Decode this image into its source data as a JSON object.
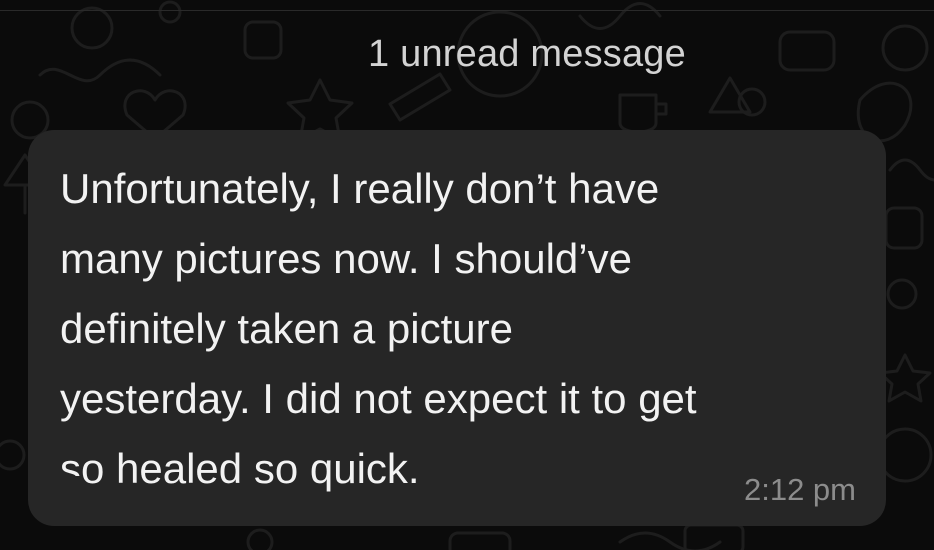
{
  "chat": {
    "unread_banner": "1 unread message",
    "message": {
      "text": "Unfortunately, I really don’t have\nmany pictures now. I should’ve\ndefinitely taken a picture\nyesterday. I did not expect it to get\nso healed so quick.",
      "timestamp": "2:12 pm"
    }
  },
  "theme": {
    "background": "#0b0b0b",
    "bubble": "#262626",
    "text": "#f2f2f2",
    "muted": "#8c8c8c"
  }
}
